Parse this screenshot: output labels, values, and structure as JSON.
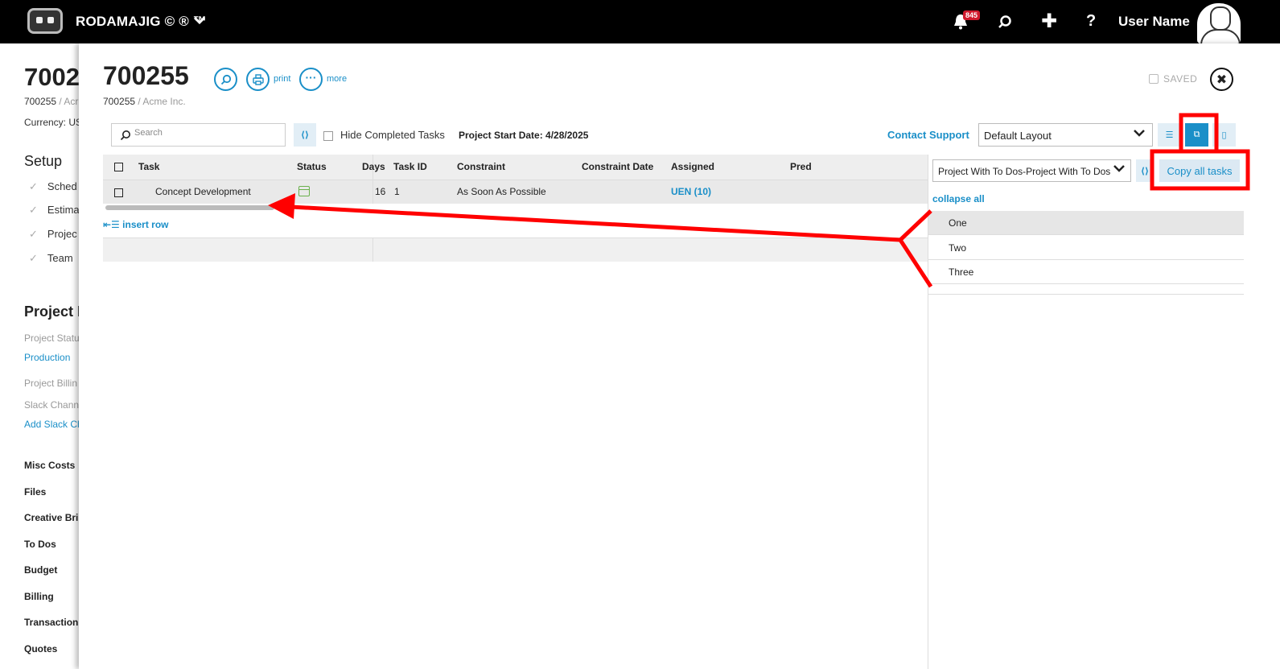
{
  "topbar": {
    "app_name": "RODAMAJIG © ® ™",
    "notification_count": "845",
    "user_name": "User Name"
  },
  "background_page": {
    "title": "7002",
    "sub_id": "700255",
    "sub_client": " / Acr",
    "currency": "Currency: US",
    "setup_heading": "Setup",
    "setup_items": [
      "Sched",
      "Estima",
      "Projec",
      "Team"
    ],
    "project_heading": "Project I",
    "project_status_label": "Project Statu",
    "project_status_value": "Production",
    "project_billing_label": "Project Billin",
    "slack_label": "Slack Channe",
    "slack_link": "Add Slack Ch",
    "nav": [
      "Misc Costs",
      "Files",
      "Creative Bri",
      "To Dos",
      "Budget",
      "Billing",
      "Transaction",
      "Quotes"
    ]
  },
  "panel": {
    "title": "700255",
    "sub_id": "700255",
    "sub_client": " / Acme Inc.",
    "print_label": "print",
    "more_label": "more",
    "saved_label": "SAVED"
  },
  "toolbar": {
    "search_placeholder": "Search",
    "hide_completed_label": "Hide Completed Tasks",
    "project_start_date": "Project Start Date: 4/28/2025",
    "contact_support": "Contact Support",
    "layout_value": "Default Layout"
  },
  "table": {
    "columns": [
      "Task",
      "Status",
      "Days",
      "Task ID",
      "Constraint",
      "Constraint Date",
      "Assigned",
      "Pred"
    ],
    "rows": [
      {
        "task": "Concept Development",
        "days": "16",
        "task_id": "1",
        "constraint": "As Soon As Possible",
        "constraint_date": "",
        "assigned": "UEN (10)",
        "pred": ""
      }
    ],
    "insert_row_label": "insert row"
  },
  "side_panel": {
    "template_value": "Project With To Dos-Project With To Dos",
    "copy_all_label": "Copy all tasks",
    "collapse_all_label": "collapse all",
    "todo_items": [
      "One",
      "Two",
      "Three"
    ]
  },
  "colors": {
    "accent": "#1a8fc8",
    "annotation": "#ff0000",
    "topbar": "#000000"
  }
}
